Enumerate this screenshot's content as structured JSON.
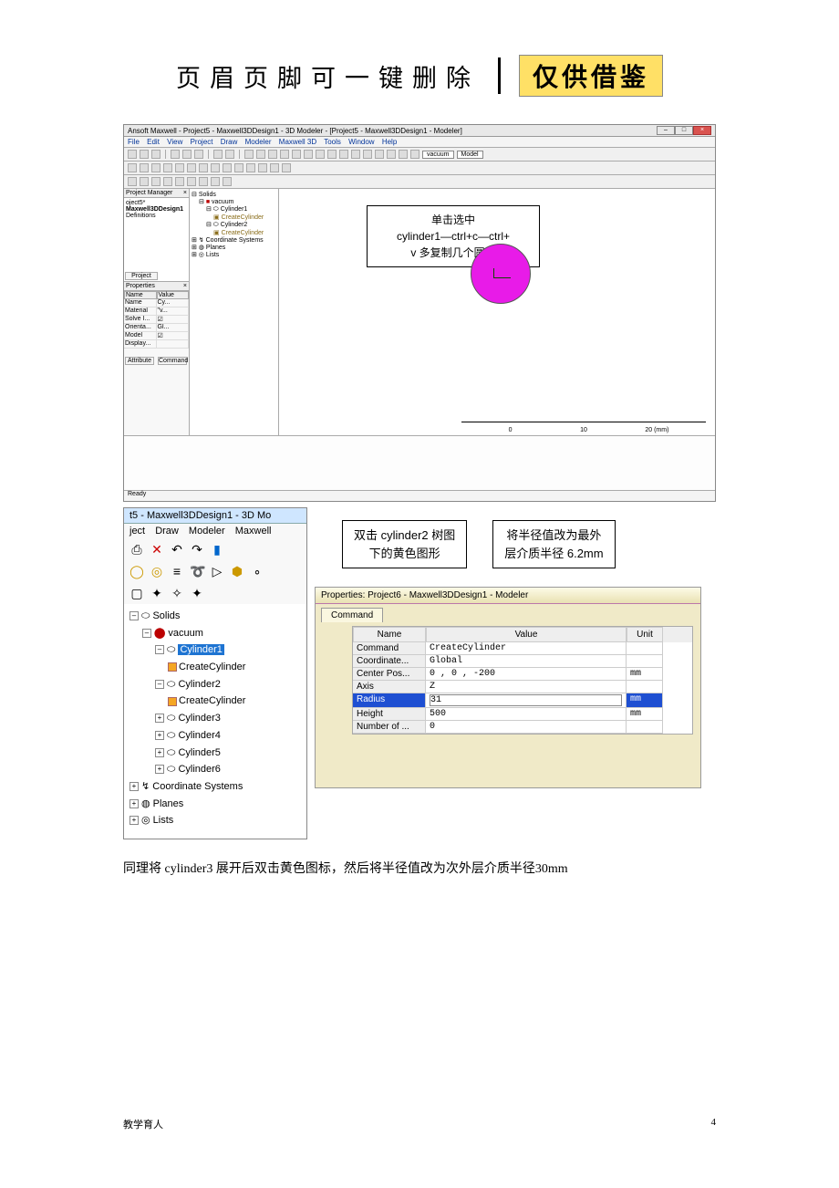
{
  "header": {
    "text": "页眉页脚可一键删除",
    "badge": "仅供借鉴"
  },
  "app1": {
    "title": "Ansoft Maxwell - Project5 - Maxwell3DDesign1 - 3D Modeler - [Project5 - Maxwell3DDesign1 - Modeler]",
    "menus": [
      "File",
      "Edit",
      "View",
      "Project",
      "Draw",
      "Modeler",
      "Maxwell 3D",
      "Tools",
      "Window",
      "Help"
    ],
    "selects": [
      "vacuum",
      "Model"
    ],
    "pm_title": "Project Manager",
    "pm": {
      "proj": "oject5*",
      "design": "Maxwell3DDesign1",
      "def": "Definitions"
    },
    "pm_tab": "Project",
    "props_title": "Properties",
    "props_cols": [
      "Name",
      "Value"
    ],
    "props": [
      {
        "n": "Name",
        "v": "Cy..."
      },
      {
        "n": "Material",
        "v": "\"v..."
      },
      {
        "n": "Solve I...",
        "v": "☑"
      },
      {
        "n": "Orienta...",
        "v": "Gl..."
      },
      {
        "n": "Model",
        "v": "☑"
      },
      {
        "n": "Display...",
        "v": ""
      }
    ],
    "attr_tab": "Attribute",
    "cmd_tab": "Command",
    "tree": {
      "root": "Solids",
      "vacuum": "vacuum",
      "c1": "Cylinder1",
      "cc1": "CreateCylinder",
      "c2": "Cylinder2",
      "cc2": "CreateCylinder",
      "cs": "Coordinate Systems",
      "pl": "Planes",
      "ls": "Lists"
    },
    "callout": {
      "l1": "单击选中",
      "l2": "cylinder1—ctrl+c—ctrl+",
      "l3": "v 多复制几个圆柱"
    },
    "ticks": {
      "t0": "0",
      "t10": "10",
      "t20": "20 (mm)"
    },
    "status": "Ready"
  },
  "app2": {
    "title": "t5 - Maxwell3DDesign1 - 3D Mo",
    "menus": [
      "ject",
      "Draw",
      "Modeler",
      "Maxwell"
    ],
    "tree": {
      "solids": "Solids",
      "vac": "vacuum",
      "c1": "Cylinder1",
      "cc1": "CreateCylinder",
      "c2": "Cylinder2",
      "cc2": "CreateCylinder",
      "c3": "Cylinder3",
      "c4": "Cylinder4",
      "c5": "Cylinder5",
      "c6": "Cylinder6",
      "cs": "Coordinate Systems",
      "pl": "Planes",
      "ls": "Lists"
    }
  },
  "callouts2": {
    "a": {
      "l1": "双击 cylinder2 树图",
      "l2": "下的黄色图形"
    },
    "b": {
      "l1": "将半径值改为最外",
      "l2": "层介质半径 6.2mm"
    }
  },
  "propwin": {
    "title": "Properties: Project6 - Maxwell3DDesign1 - Modeler",
    "tab": "Command",
    "cols": {
      "name": "Name",
      "value": "Value",
      "unit": "Unit"
    },
    "rows": [
      {
        "n": "Command",
        "v": "CreateCylinder",
        "u": ""
      },
      {
        "n": "Coordinate...",
        "v": "Global",
        "u": ""
      },
      {
        "n": "Center Pos...",
        "v": "0 , 0 , -200",
        "u": "mm"
      },
      {
        "n": "Axis",
        "v": "Z",
        "u": ""
      },
      {
        "n": "Radius",
        "v": "31",
        "u": "mm"
      },
      {
        "n": "Height",
        "v": "500",
        "u": "mm"
      },
      {
        "n": "Number of ...",
        "v": "0",
        "u": ""
      }
    ]
  },
  "bodytext": "同理将 cylinder3 展开后双击黄色图标，然后将半径值改为次外层介质半径30mm",
  "footer": {
    "left": "教学育人",
    "right": "4"
  }
}
